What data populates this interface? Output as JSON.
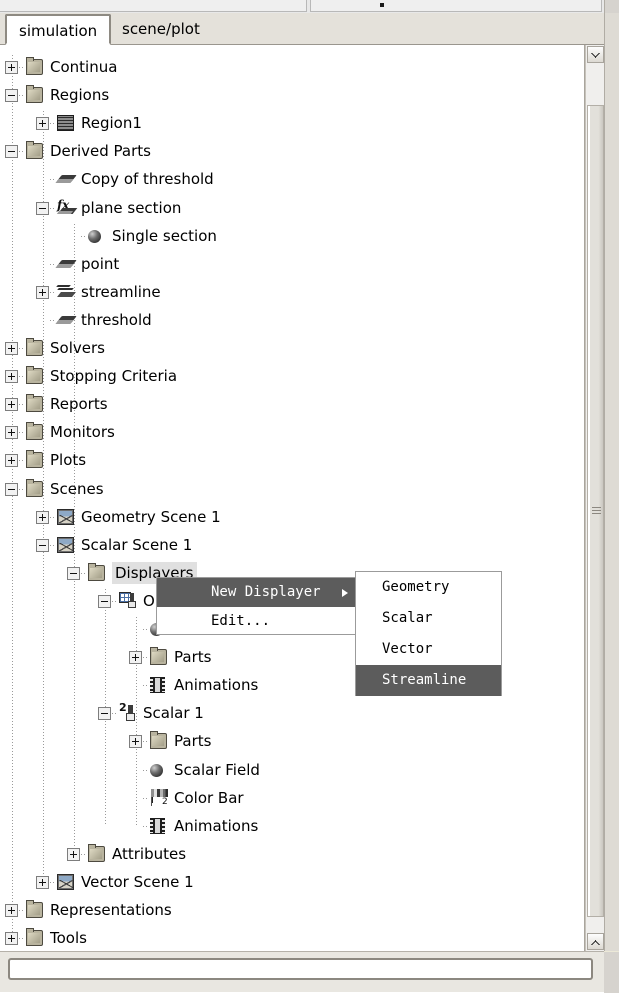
{
  "window": {
    "tabs": [
      {
        "label": "simulation",
        "active": true
      },
      {
        "label": "scene/plot",
        "active": false
      }
    ]
  },
  "tree": {
    "nodes": [
      {
        "label": "Continua",
        "depth": 0,
        "expander": "plus",
        "icon": "folder-icon"
      },
      {
        "label": "Regions",
        "depth": 0,
        "expander": "minus",
        "icon": "folder-icon"
      },
      {
        "label": "Region1",
        "depth": 1,
        "expander": "plus",
        "icon": "region-icon"
      },
      {
        "label": "Derived Parts",
        "depth": 0,
        "expander": "minus",
        "icon": "folder-icon"
      },
      {
        "label": "Copy of threshold",
        "depth": 1,
        "expander": "none",
        "icon": "plane-icon"
      },
      {
        "label": "plane section",
        "depth": 1,
        "expander": "minus",
        "icon": "function-plane-icon"
      },
      {
        "label": "Single section",
        "depth": 2,
        "expander": "none",
        "icon": "sphere-icon"
      },
      {
        "label": "point",
        "depth": 1,
        "expander": "none",
        "icon": "plane-icon"
      },
      {
        "label": "streamline",
        "depth": 1,
        "expander": "plus",
        "icon": "streamline-icon"
      },
      {
        "label": "threshold",
        "depth": 1,
        "expander": "none",
        "icon": "plane-icon"
      },
      {
        "label": "Solvers",
        "depth": 0,
        "expander": "plus",
        "icon": "folder-icon"
      },
      {
        "label": "Stopping Criteria",
        "depth": 0,
        "expander": "plus",
        "icon": "folder-icon"
      },
      {
        "label": "Reports",
        "depth": 0,
        "expander": "plus",
        "icon": "folder-icon"
      },
      {
        "label": "Monitors",
        "depth": 0,
        "expander": "plus",
        "icon": "folder-icon"
      },
      {
        "label": "Plots",
        "depth": 0,
        "expander": "plus",
        "icon": "folder-icon"
      },
      {
        "label": "Scenes",
        "depth": 0,
        "expander": "minus",
        "icon": "folder-icon"
      },
      {
        "label": "Geometry Scene 1",
        "depth": 1,
        "expander": "plus",
        "icon": "scene-icon"
      },
      {
        "label": "Scalar Scene 1",
        "depth": 1,
        "expander": "minus",
        "icon": "scene-icon"
      },
      {
        "label": "Displayers",
        "depth": 2,
        "expander": "minus",
        "icon": "folder-icon",
        "selected": true
      },
      {
        "label": "Ou",
        "depth": 3,
        "expander": "minus",
        "icon": "outline-icon"
      },
      {
        "label": "",
        "depth": 4,
        "expander": "none",
        "icon": "sphere-icon"
      },
      {
        "label": "Parts",
        "depth": 4,
        "expander": "plus",
        "icon": "folder-icon"
      },
      {
        "label": "Animations",
        "depth": 4,
        "expander": "none",
        "icon": "film-icon"
      },
      {
        "label": "Scalar 1",
        "depth": 3,
        "expander": "minus",
        "icon": "scalar-icon"
      },
      {
        "label": "Parts",
        "depth": 4,
        "expander": "plus",
        "icon": "folder-icon"
      },
      {
        "label": "Scalar Field",
        "depth": 4,
        "expander": "none",
        "icon": "sphere-icon"
      },
      {
        "label": "Color Bar",
        "depth": 4,
        "expander": "none",
        "icon": "color-bar-icon"
      },
      {
        "label": "Animations",
        "depth": 4,
        "expander": "none",
        "icon": "film-icon"
      },
      {
        "label": "Attributes",
        "depth": 2,
        "expander": "plus",
        "icon": "folder-icon"
      },
      {
        "label": "Vector Scene 1",
        "depth": 1,
        "expander": "plus",
        "icon": "scene-icon"
      },
      {
        "label": "Representations",
        "depth": 0,
        "expander": "plus",
        "icon": "folder-icon"
      },
      {
        "label": "Tools",
        "depth": 0,
        "expander": "plus",
        "icon": "folder-icon"
      }
    ],
    "scalar_icon_superscript": "2"
  },
  "context_menu": {
    "items": [
      {
        "label": "New Displayer",
        "highlighted": true,
        "submenu": true
      },
      {
        "label": "Edit...",
        "highlighted": false,
        "submenu": false
      }
    ],
    "submenu": {
      "items": [
        {
          "label": "Geometry",
          "highlighted": false
        },
        {
          "label": "Scalar",
          "highlighted": false
        },
        {
          "label": "Vector",
          "highlighted": false
        },
        {
          "label": "Streamline",
          "highlighted": true
        }
      ]
    }
  },
  "bottom_field": {
    "value": "",
    "placeholder": ""
  },
  "colors": {
    "menu_highlight": "#5c5c5c",
    "selection": "#e0e0e0",
    "panel_bg": "#ffffff",
    "chrome_bg": "#e4e1da"
  }
}
